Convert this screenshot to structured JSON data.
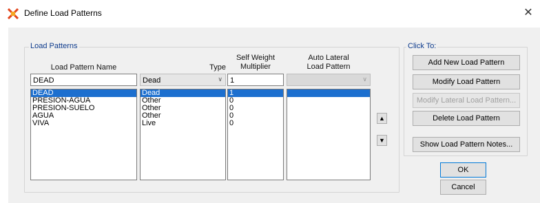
{
  "window": {
    "title": "Define Load Patterns",
    "close_glyph": "✕"
  },
  "load_patterns": {
    "legend": "Load Patterns",
    "headers": {
      "name": "Load Pattern Name",
      "type": "Type",
      "self_weight_line1": "Self Weight",
      "self_weight_line2": "Multiplier",
      "auto_lateral_line1": "Auto Lateral",
      "auto_lateral_line2": "Load Pattern"
    },
    "edit": {
      "name_value": "DEAD",
      "type_value": "Dead",
      "multiplier_value": "1",
      "auto_lateral_value": ""
    },
    "rows": [
      {
        "name": "DEAD",
        "type": "Dead",
        "multiplier": "1",
        "auto_lateral": ""
      },
      {
        "name": "PRESION-AGUA",
        "type": "Other",
        "multiplier": "0",
        "auto_lateral": ""
      },
      {
        "name": "PRESION-SUELO",
        "type": "Other",
        "multiplier": "0",
        "auto_lateral": ""
      },
      {
        "name": "AGUA",
        "type": "Other",
        "multiplier": "0",
        "auto_lateral": ""
      },
      {
        "name": "VIVA",
        "type": "Live",
        "multiplier": "0",
        "auto_lateral": ""
      }
    ],
    "selected_index": 0
  },
  "click_to": {
    "legend": "Click To:",
    "add": "Add New Load Pattern",
    "modify": "Modify Load Pattern",
    "modify_lateral": "Modify Lateral Load Pattern...",
    "delete": "Delete Load Pattern",
    "notes": "Show Load Pattern Notes..."
  },
  "footer": {
    "ok": "OK",
    "cancel": "Cancel"
  },
  "icons": {
    "move_up": "move-up-icon",
    "move_down": "move-down-icon",
    "app": "app-logo-icon"
  },
  "colors": {
    "selection": "#1c6fcf",
    "legend_text": "#0c3a8c"
  }
}
